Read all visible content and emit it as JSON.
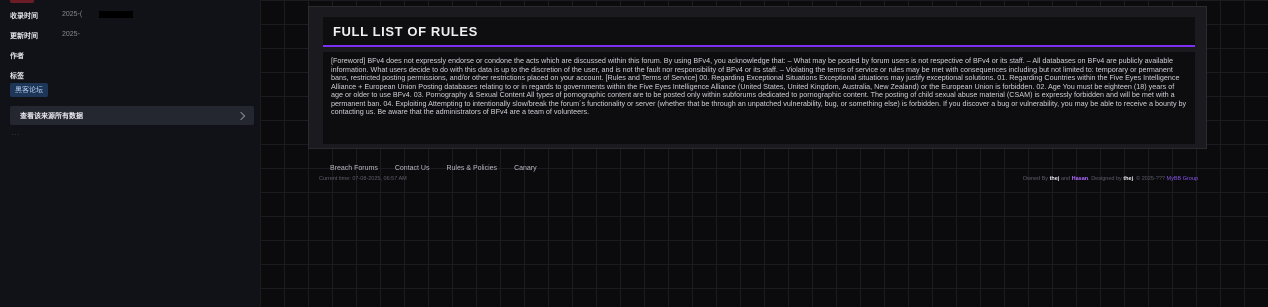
{
  "sidebar": {
    "collected_label": "收录时间",
    "collected_value": "2025-(",
    "updated_label": "更新时间",
    "updated_value": "2025-",
    "author_label": "作者",
    "tags_label": "标签",
    "tag": "黑客论坛",
    "view_all": "查看该来源所有数据",
    "more": "..."
  },
  "card": {
    "title": "FULL LIST OF RULES",
    "body": "[Foreword] BFv4 does not expressly endorse or condone the acts which are discussed within this forum. By using BFv4, you acknowledge that: – What may be posted by forum users is not respective of BFv4 or its staff. – All databases on BFv4 are publicly available information. What users decide to do with this data is up to the discretion of the user, and is not the fault nor responsibility of BFv4 or its staff. – Violating the terms of service or rules may be met with consequences including but not limited to: temporary or permanent bans, restricted posting permissions, and/or other restrictions placed on your account. [Rules and Terms of Service] 00. Regarding Exceptional Situations Exceptional situations may justify exceptional solutions. 01. Regarding Countries within the Five Eyes Intelligence Alliance + European Union Posting databases relating to or in regards to governments within the Five Eyes Intelligence Alliance (United States, United Kingdom, Australia, New Zealand) or the European Union is forbidden. 02. Age You must be eighteen (18) years of age or older to use BFv4. 03. Pornography & Sexual Content All types of pornographic content are to be posted only within subforums dedicated to pornographic content. The posting of child sexual abuse material (CSAM) is expressly forbidden and will be met with a permanent ban. 04. Exploiting Attempting to intentionally slow/break the forum´s functionality or server (whether that be through an unpatched vulnerability, bug, or something else) is forbidden. If you discover a bug or vulnerability, you may be able to receive a bounty by contacting us. Be aware that the administrators of BFv4 are a team of volunteers."
  },
  "footer": {
    "links": [
      "Breach Forums",
      "Contact Us",
      "Rules & Policies",
      "Canary"
    ],
    "time": "Current time: 07-08-2025, 06:57 AM",
    "owned_by": "Owned By",
    "owner1": "thej",
    "and": "and",
    "owner2": "Hasan",
    "designed_by": ". Designed by",
    "designer": "thej",
    "copyright": ". © 2025-???",
    "powered": "MyBB Group"
  },
  "colors": {
    "accent": "#7b2ff2",
    "tag_bg": "#1d3557",
    "background": "#0b0b0e"
  }
}
